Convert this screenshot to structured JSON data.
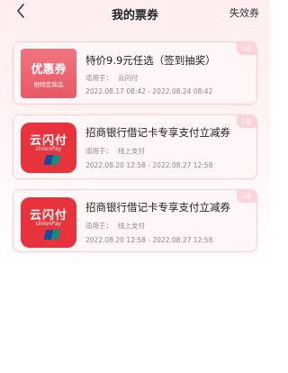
{
  "header": {
    "title": "我的票券",
    "expired_label": "失效券"
  },
  "coupons": [
    {
      "badge_main": "优惠券",
      "badge_sub": "限特定商品",
      "title": "特价9.9元任选（签到抽奖）",
      "scope_label": "适用于：",
      "scope_value": "云闪付",
      "date_range": "2022.08.17 08:42 - 2022.08.24 08:42",
      "count": "1张"
    },
    {
      "logo_text": "云闪付",
      "logo_subtext": "UnionPay",
      "title": "招商银行借记卡专享支付立减券",
      "scope_label": "适用于：",
      "scope_value": "线上支付",
      "date_range": "2022.08.20 12:58 - 2022.08.27 12:58",
      "count": "1张"
    },
    {
      "logo_text": "云闪付",
      "logo_subtext": "UnionPay",
      "title": "招商银行借记卡专享支付立减券",
      "scope_label": "适用于：",
      "scope_value": "线上支付",
      "date_range": "2022.08.20 12:58 - 2022.08.27 12:58",
      "count": "1张"
    }
  ],
  "colors": {
    "brand_red": "#e8323c",
    "coupon_badge": "#ec6670",
    "card_bg": "#fff6f7",
    "card_border": "#f6d2d6",
    "unionpay_stripes": [
      "#e8323c",
      "#1a4a9a",
      "#1a8a7a"
    ]
  },
  "icons": {
    "back": "chevron-left-icon",
    "unionpay": "unionpay-logo"
  }
}
